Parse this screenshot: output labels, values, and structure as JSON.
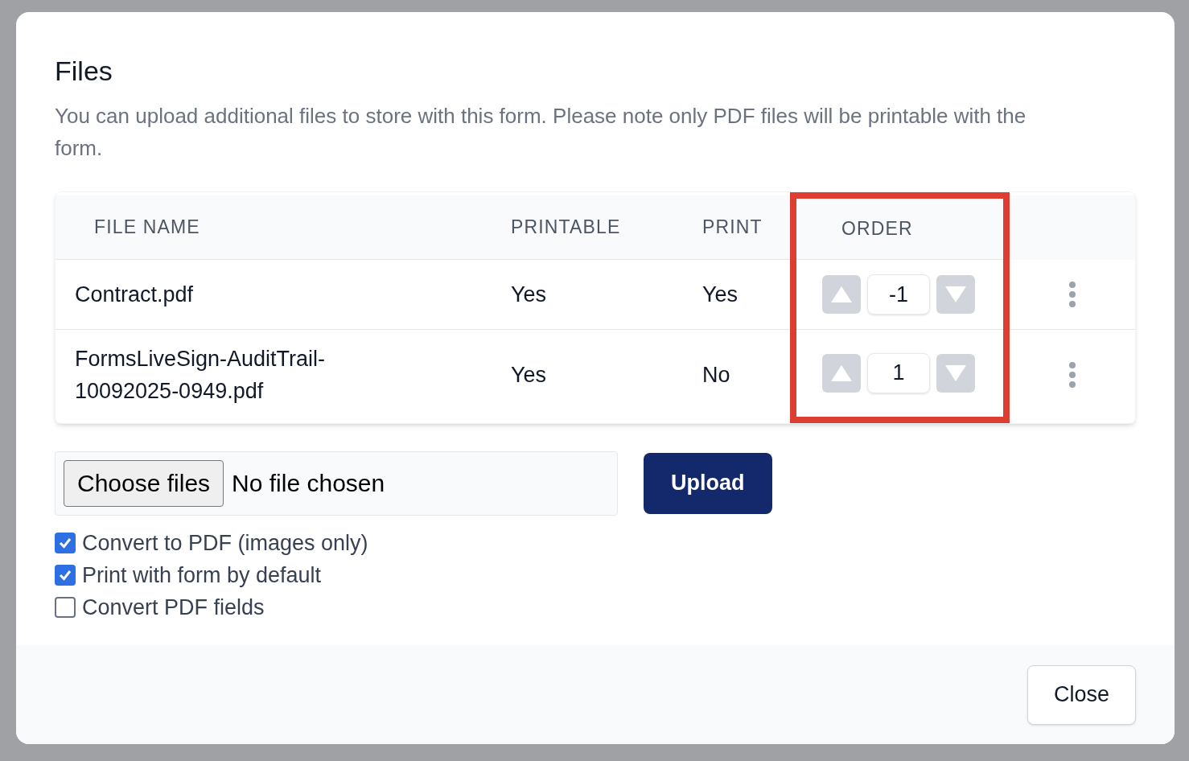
{
  "dialog": {
    "title": "Files",
    "description": "You can upload additional files to store with this form. Please note only PDF files will be printable with the form."
  },
  "table": {
    "columns": [
      {
        "label": "FILE NAME",
        "highlighted": false
      },
      {
        "label": "PRINTABLE",
        "highlighted": false
      },
      {
        "label": "PRINT",
        "highlighted": false
      },
      {
        "label": "ORDER",
        "highlighted": true
      }
    ],
    "rows": [
      {
        "file_name": "Contract.pdf",
        "printable": "Yes",
        "print": "Yes",
        "order": "-1"
      },
      {
        "file_name": "FormsLiveSign-AuditTrail-10092025-0949.pdf",
        "printable": "Yes",
        "print": "No",
        "order": "1"
      }
    ]
  },
  "file_input": {
    "button": "Choose files",
    "status": "No file chosen"
  },
  "upload_button": "Upload",
  "options": [
    {
      "label": "Convert to PDF (images only)",
      "checked": true
    },
    {
      "label": "Print with form by default",
      "checked": true
    },
    {
      "label": "Convert PDF fields",
      "checked": false
    }
  ],
  "close_button": "Close"
}
